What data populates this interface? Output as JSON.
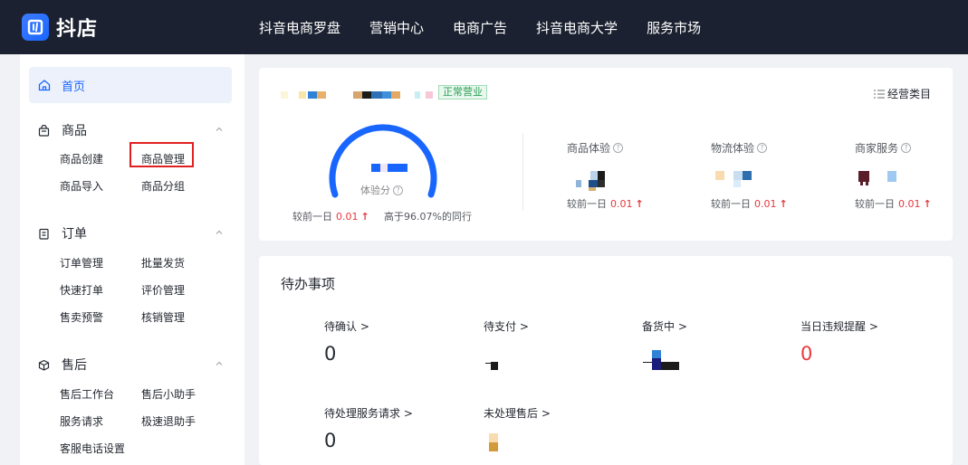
{
  "app": {
    "logo_text": "抖店"
  },
  "nav": [
    "抖音电商罗盘",
    "营销中心",
    "电商广告",
    "抖音电商大学",
    "服务市场"
  ],
  "sidebar": {
    "home": "首页",
    "groups": [
      {
        "title": "商品",
        "items": [
          "商品创建",
          "商品管理",
          "商品导入",
          "商品分组"
        ]
      },
      {
        "title": "订单",
        "items": [
          "订单管理",
          "批量发货",
          "快速打单",
          "评价管理",
          "售卖预警",
          "核销管理"
        ]
      },
      {
        "title": "售后",
        "items": [
          "售后工作台",
          "售后小助手",
          "服务请求",
          "极速退助手",
          "客服电话设置"
        ]
      }
    ]
  },
  "overview": {
    "status": "正常营业",
    "category_btn": "经营类目",
    "score_label": "体验分",
    "score_compare_prefix": "较前一日",
    "score_compare_value": "0.01",
    "score_rank": "高于96.07%的同行",
    "metrics": [
      {
        "title": "商品体验",
        "compare_prefix": "较前一日",
        "compare_value": "0.01"
      },
      {
        "title": "物流体验",
        "compare_prefix": "较前一日",
        "compare_value": "0.01"
      },
      {
        "title": "商家服务",
        "compare_prefix": "较前一日",
        "compare_value": "0.01"
      }
    ]
  },
  "todo": {
    "title": "待办事项",
    "items": [
      {
        "label": "待确认",
        "value": "0"
      },
      {
        "label": "待支付",
        "value": ""
      },
      {
        "label": "备货中",
        "value": ""
      },
      {
        "label": "当日违规提醒",
        "value": "0"
      },
      {
        "label": "待处理服务请求",
        "value": "0"
      },
      {
        "label": "未处理售后",
        "value": ""
      }
    ]
  },
  "colors": {
    "accent": "#1966ff",
    "danger": "#e8383d",
    "topbar": "#1b2130"
  }
}
